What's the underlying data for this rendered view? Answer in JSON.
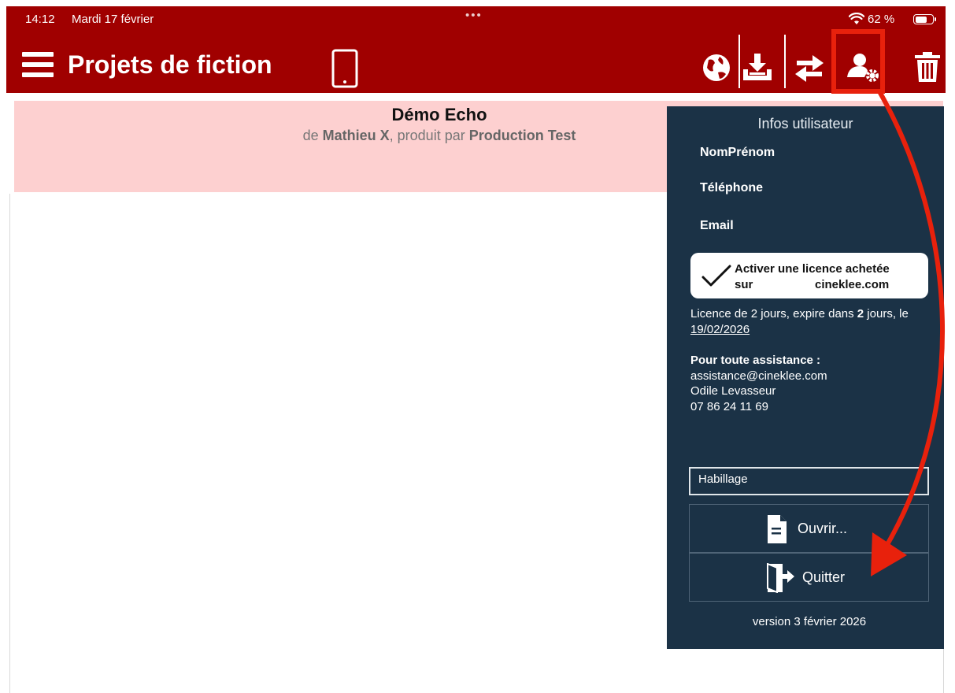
{
  "status_bar": {
    "time": "14:12",
    "date": "Mardi 17 février",
    "dots": "•••",
    "battery": "62 %"
  },
  "header": {
    "title": "Projets de fiction",
    "icons": [
      "menu-icon",
      "tablet-icon",
      "globe-icon",
      "download-tray-icon",
      "swap-arrows-icon",
      "user-settings-icon",
      "trash-icon"
    ]
  },
  "project": {
    "title": "Démo Echo",
    "by_prefix": "de ",
    "author": "Mathieu X",
    "produced_by": ", produit par ",
    "producer": "Production Test"
  },
  "user_panel": {
    "title": "Infos utilisateur",
    "name_label": "NomPrénom",
    "phone_label": "Téléphone",
    "email_label": "Email",
    "license_button": {
      "line1": "Activer une licence achetée",
      "line2_prefix": "sur",
      "line2_site": "cineklee.com"
    },
    "license_info": {
      "part1": "Licence de 2 jours, expire dans ",
      "days": "2",
      "part2": " jours, le ",
      "date": "19/02/2026"
    },
    "assistance": {
      "heading": "Pour toute assistance :",
      "email": "assistance@cineklee.com",
      "contact": "Odile Levasseur",
      "phone": "07 86 24 11 69"
    },
    "skin_label": "Habillage",
    "open_button": "Ouvrir...",
    "quit_button": "Quitter",
    "version": "version  3 février 2026"
  },
  "colors": {
    "header_red": "#a00000",
    "project_pink": "#fdd0d0",
    "panel_navy": "#1b3246",
    "annotation_red": "#e8210c"
  }
}
